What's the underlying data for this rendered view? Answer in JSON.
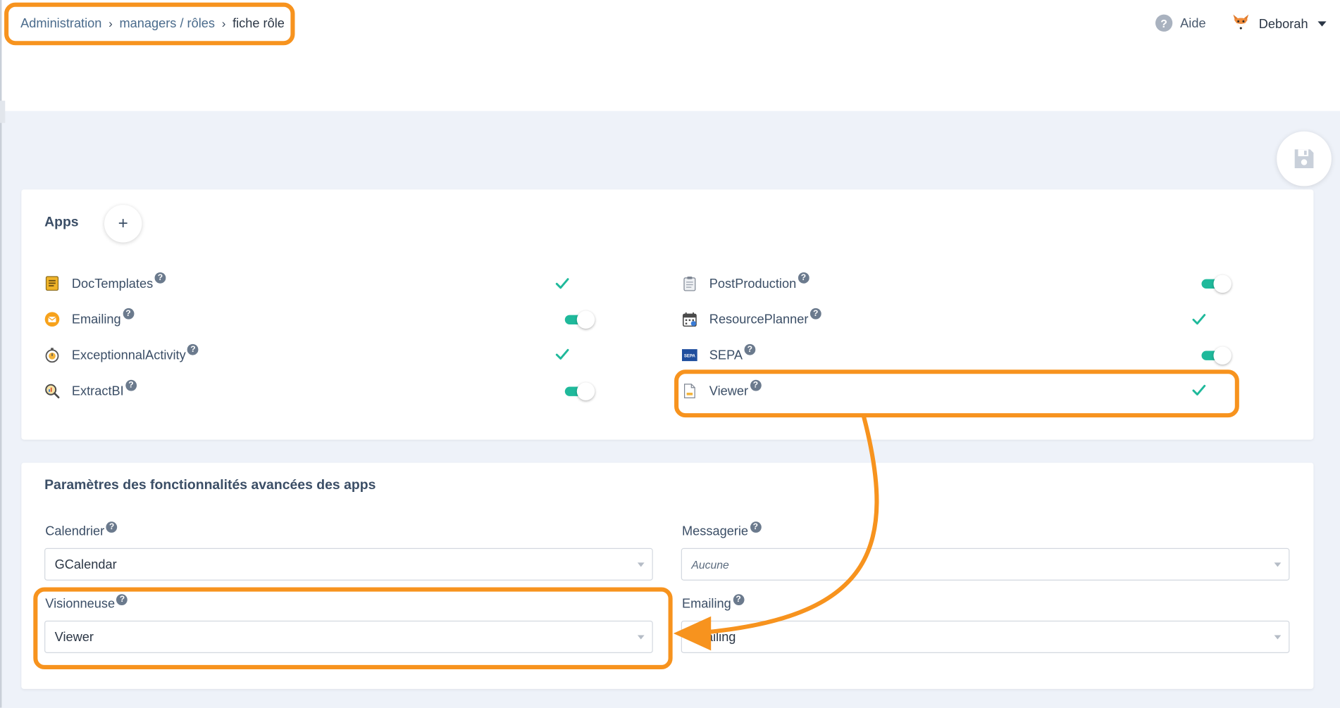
{
  "breadcrumb": {
    "items": [
      "Administration",
      "managers / rôles"
    ],
    "current": "fiche rôle"
  },
  "header": {
    "help_label": "Aide",
    "user_name": "Deborah"
  },
  "apps": {
    "title": "Apps",
    "add_label": "+",
    "left": [
      {
        "name": "DocTemplates",
        "state": "check",
        "icon": "doc-template-icon"
      },
      {
        "name": "Emailing",
        "state": "toggle-on",
        "icon": "email-icon"
      },
      {
        "name": "ExceptionnalActivity",
        "state": "check",
        "icon": "stopwatch-icon"
      },
      {
        "name": "ExtractBI",
        "state": "toggle-on",
        "icon": "magnifier-icon"
      }
    ],
    "right": [
      {
        "name": "PostProduction",
        "state": "toggle-on",
        "icon": "clipboard-icon"
      },
      {
        "name": "ResourcePlanner",
        "state": "check",
        "icon": "calendar-icon"
      },
      {
        "name": "SEPA",
        "state": "toggle-on",
        "icon": "sepa-icon"
      },
      {
        "name": "Viewer",
        "state": "check",
        "icon": "document-icon"
      }
    ]
  },
  "params": {
    "title": "Paramètres des fonctionnalités avancées des apps",
    "calendar": {
      "label": "Calendrier",
      "value": "GCalendar"
    },
    "messaging": {
      "label": "Messagerie",
      "placeholder": "Aucune"
    },
    "viewer": {
      "label": "Visionneuse",
      "value": "Viewer"
    },
    "emailing": {
      "label": "Emailing",
      "value": "ailing"
    }
  },
  "sepa_badge": "SEPA",
  "colors": {
    "accent": "#1fb99b",
    "highlight": "#f7931e",
    "text": "#3b4e66",
    "link": "#4a6b8c",
    "background": "#eef2f9"
  }
}
